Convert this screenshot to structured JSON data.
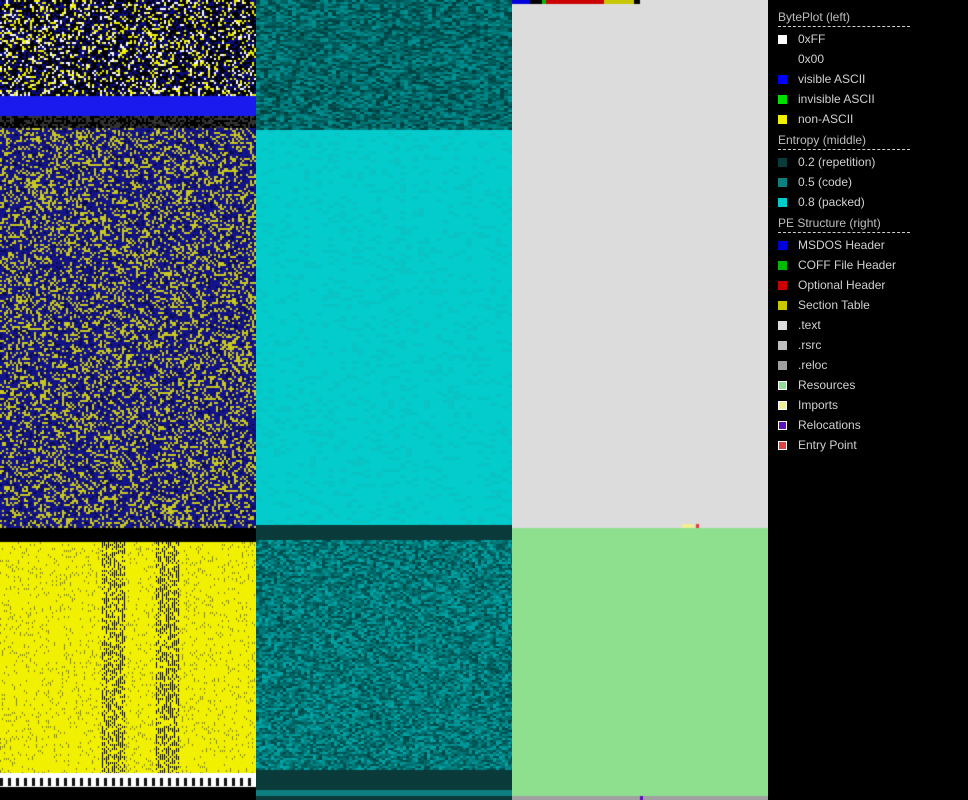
{
  "legend": {
    "sections": [
      {
        "title": "BytePlot (left)",
        "items": [
          {
            "label": "0xFF",
            "color": "#ffffff",
            "name": "legend-item-0xff"
          },
          {
            "label": "0x00",
            "color": "#000000",
            "name": "legend-item-0x00"
          },
          {
            "label": "visible ASCII",
            "color": "#0000ff",
            "name": "legend-item-visible-ascii"
          },
          {
            "label": "invisible ASCII",
            "color": "#00e000",
            "name": "legend-item-invisible-ascii"
          },
          {
            "label": "non-ASCII",
            "color": "#f0f000",
            "name": "legend-item-non-ascii"
          }
        ]
      },
      {
        "title": "Entropy (middle)",
        "items": [
          {
            "label": "0.2 (repetition)",
            "color": "#0a3a3a",
            "name": "legend-item-entropy-0-2"
          },
          {
            "label": "0.5 (code)",
            "color": "#0d7f80",
            "name": "legend-item-entropy-0-5"
          },
          {
            "label": "0.8 (packed)",
            "color": "#00cccc",
            "name": "legend-item-entropy-0-8"
          }
        ]
      },
      {
        "title": "PE Structure (right)",
        "items": [
          {
            "label": "MSDOS Header",
            "color": "#0000dd",
            "name": "legend-item-msdos-header"
          },
          {
            "label": "COFF File Header",
            "color": "#00bb00",
            "name": "legend-item-coff-file-header"
          },
          {
            "label": "Optional Header",
            "color": "#cc0000",
            "name": "legend-item-optional-header"
          },
          {
            "label": "Section Table",
            "color": "#c8c800",
            "name": "legend-item-section-table"
          },
          {
            "label": ".text",
            "color": "#dcdcdc",
            "name": "legend-item-text"
          },
          {
            "label": ".rsrc",
            "color": "#c0c0c0",
            "name": "legend-item-rsrc"
          },
          {
            "label": ".reloc",
            "color": "#a0a0a0",
            "name": "legend-item-reloc"
          },
          {
            "label": "Resources",
            "color": "#8ee08e",
            "name": "legend-item-resources"
          },
          {
            "label": "Imports",
            "color": "#f0f090",
            "name": "legend-item-imports"
          },
          {
            "label": "Relocations",
            "color": "#6010c0",
            "name": "legend-item-relocations"
          },
          {
            "label": "Entry Point",
            "color": "#e04040",
            "name": "legend-item-entry-point"
          }
        ]
      }
    ]
  }
}
